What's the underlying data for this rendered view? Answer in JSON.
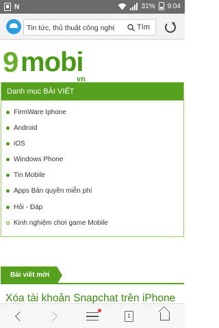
{
  "status_bar": {
    "battery": "31%",
    "time": "9:04",
    "icons": [
      "sim-icon",
      "n-icon",
      "wifi-icon",
      "signal-icon",
      "battery-icon"
    ]
  },
  "browser": {
    "url_text": "Tin tức, thủ thuật công nghệ",
    "search_label": "Tìm",
    "icons": [
      "browser-logo-icon",
      "search-icon",
      "reload-icon"
    ]
  },
  "site": {
    "logo_prefix": "9",
    "logo_main": "mobi",
    "logo_suffix": "vn",
    "accent_color": "#55a01d"
  },
  "menu": {
    "title": "Danh mục BÀI VIẾT",
    "items": [
      {
        "label": "FirmWare Iphone"
      },
      {
        "label": "Android"
      },
      {
        "label": "iOS"
      },
      {
        "label": "Windows Phone"
      },
      {
        "label": "Tin Mobile"
      },
      {
        "label": "Apps Bản quyền miễn phí"
      },
      {
        "label": "Hỏi - Đáp"
      },
      {
        "label": "Kinh nghiệm chơi game Mobile"
      }
    ]
  },
  "latest": {
    "header": "Bài viết mới",
    "first_title": "Xóa tài khoản Snapchat trên iPhone"
  },
  "bottom_bar": {
    "tab_count": "1",
    "icons": [
      "back-icon",
      "forward-icon",
      "menu-icon",
      "tabs-icon",
      "home-icon"
    ]
  }
}
